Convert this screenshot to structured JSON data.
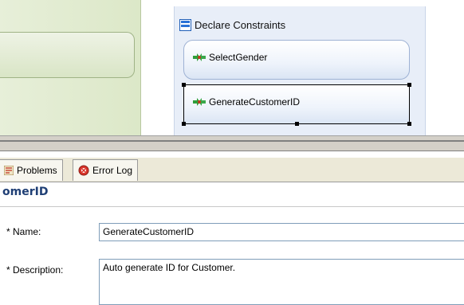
{
  "diagram": {
    "container_title": "Declare Constraints",
    "tasks": [
      {
        "label": "SelectGender",
        "selected": false
      },
      {
        "label": "GenerateCustomerID",
        "selected": true
      }
    ]
  },
  "tabs": [
    {
      "label": "Problems",
      "icon": "problems-icon"
    },
    {
      "label": "Error Log",
      "icon": "error-log-icon"
    }
  ],
  "properties": {
    "title": "omerID",
    "name_label": "* Name:",
    "name_value": "GenerateCustomerID",
    "description_label": "* Description:",
    "description_value": "Auto generate ID for Customer."
  },
  "colors": {
    "container_bg": "#e8eef8",
    "task_border": "#9eb2d4",
    "title_color": "#1f3f75",
    "left_pane": "#dce8c8"
  }
}
